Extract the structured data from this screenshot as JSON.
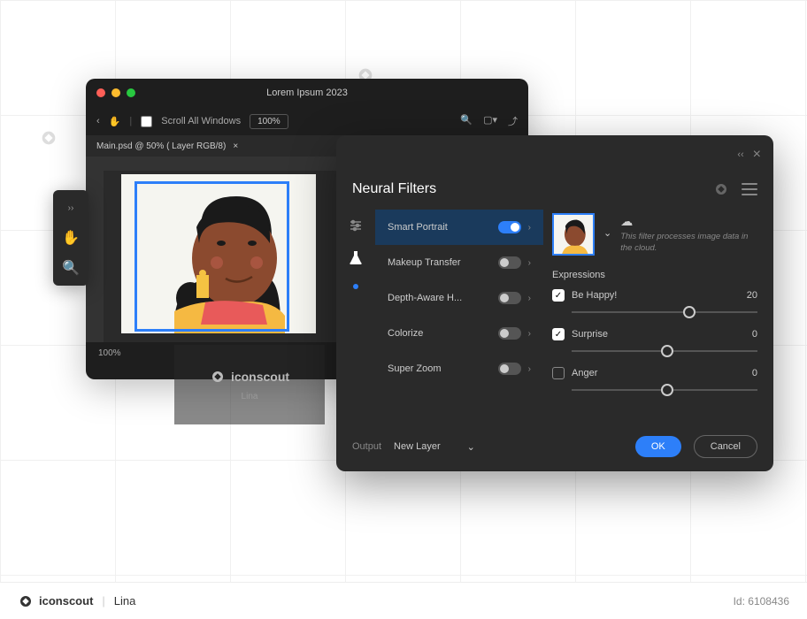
{
  "watermark_brand": "iconscout",
  "main_window": {
    "title": "Lorem Ipsum 2023",
    "scroll_label": "Scroll All Windows",
    "zoom_box": "100%",
    "tab_label": "Main.psd @ 50% ( Layer RGB/8)",
    "canvas_zoom": "100%"
  },
  "panel": {
    "title": "Neural Filters",
    "filters": [
      {
        "label": "Smart Portrait",
        "on": true,
        "active": true
      },
      {
        "label": "Makeup Transfer",
        "on": false
      },
      {
        "label": "Depth-Aware H...",
        "on": false
      },
      {
        "label": "Colorize",
        "on": false
      },
      {
        "label": "Super Zoom",
        "on": false
      }
    ],
    "cloud_text": "This filter processes image data in the cloud.",
    "section_title": "Expressions",
    "controls": [
      {
        "label": "Be Happy!",
        "checked": true,
        "value": "20",
        "knob": 60
      },
      {
        "label": "Surprise",
        "checked": true,
        "value": "0",
        "knob": 48
      },
      {
        "label": "Anger",
        "checked": false,
        "value": "0",
        "knob": 48
      }
    ],
    "output_label": "Output",
    "output_value": "New Layer",
    "ok_label": "OK",
    "cancel_label": "Cancel"
  },
  "attrib": {
    "brand": "iconscout",
    "author": "Lina"
  },
  "bottom": {
    "brand": "iconscout",
    "author": "Lina",
    "id": "Id: 6108436"
  }
}
